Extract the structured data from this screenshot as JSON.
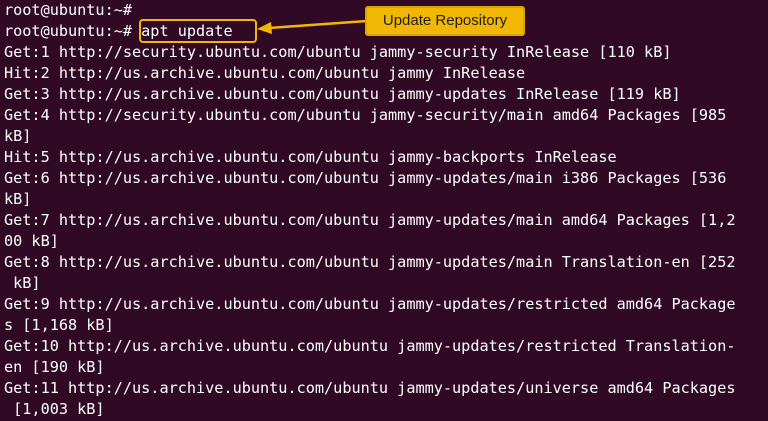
{
  "terminal": {
    "prompt": "root@ubuntu:~#",
    "command": "apt update",
    "lines": [
      "root@ubuntu:~#",
      "root@ubuntu:~# apt update",
      "Get:1 http://security.ubuntu.com/ubuntu jammy-security InRelease [110 kB]",
      "Hit:2 http://us.archive.ubuntu.com/ubuntu jammy InRelease",
      "Get:3 http://us.archive.ubuntu.com/ubuntu jammy-updates InRelease [119 kB]",
      "Get:4 http://security.ubuntu.com/ubuntu jammy-security/main amd64 Packages [985",
      "kB]",
      "Hit:5 http://us.archive.ubuntu.com/ubuntu jammy-backports InRelease",
      "Get:6 http://us.archive.ubuntu.com/ubuntu jammy-updates/main i386 Packages [536",
      "kB]",
      "Get:7 http://us.archive.ubuntu.com/ubuntu jammy-updates/main amd64 Packages [1,2",
      "00 kB]",
      "Get:8 http://us.archive.ubuntu.com/ubuntu jammy-updates/main Translation-en [252",
      " kB]",
      "Get:9 http://us.archive.ubuntu.com/ubuntu jammy-updates/restricted amd64 Package",
      "s [1,168 kB]",
      "Get:10 http://us.archive.ubuntu.com/ubuntu jammy-updates/restricted Translation-",
      "en [190 kB]",
      "Get:11 http://us.archive.ubuntu.com/ubuntu jammy-updates/universe amd64 Packages",
      " [1,003 kB]"
    ]
  },
  "annotation": {
    "label": "Update Repository",
    "color": "#f2b705"
  },
  "colors": {
    "background": "#300a24",
    "text": "#ffffff"
  }
}
